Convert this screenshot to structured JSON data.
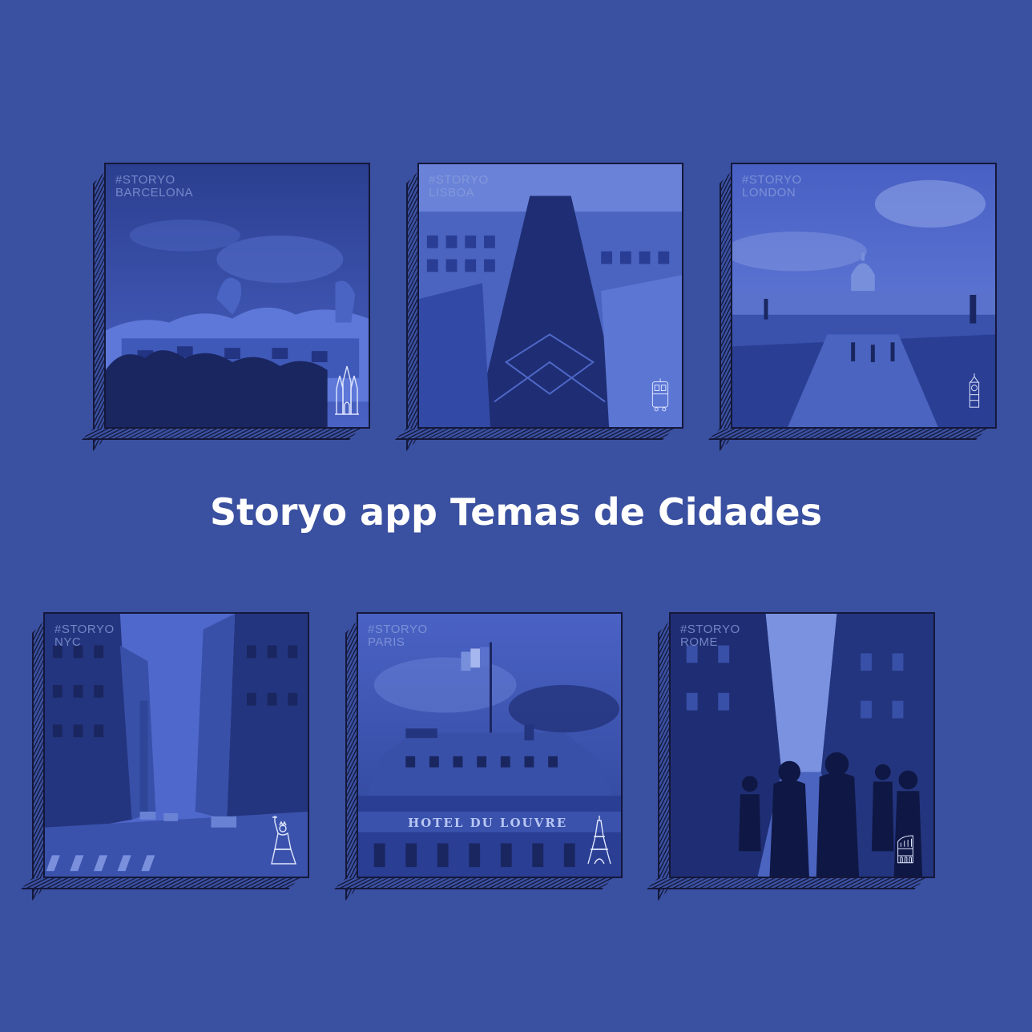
{
  "title": "Storyo app Temas de Cidades",
  "cards": [
    {
      "tag": "#STORYO",
      "city": "BARCELONA"
    },
    {
      "tag": "#STORYO",
      "city": "LISBOA"
    },
    {
      "tag": "#STORYO",
      "city": "LONDON"
    },
    {
      "tag": "#STORYO",
      "city": "NYC"
    },
    {
      "tag": "#STORYO",
      "city": "PARIS"
    },
    {
      "tag": "#STORYO",
      "city": "ROME"
    }
  ],
  "photo_texts": {
    "paris_hotel": "HOTEL DU LOUVRE"
  },
  "icons": [
    "sagrada-familia-icon",
    "tram-icon",
    "big-ben-icon",
    "statue-of-liberty-icon",
    "eiffel-tower-icon",
    "colosseum-icon"
  ],
  "colors": {
    "background": "#3a50a0",
    "outline": "#14183a",
    "duotone_dark": "#1a2560",
    "duotone_light": "#4f6ad0"
  }
}
